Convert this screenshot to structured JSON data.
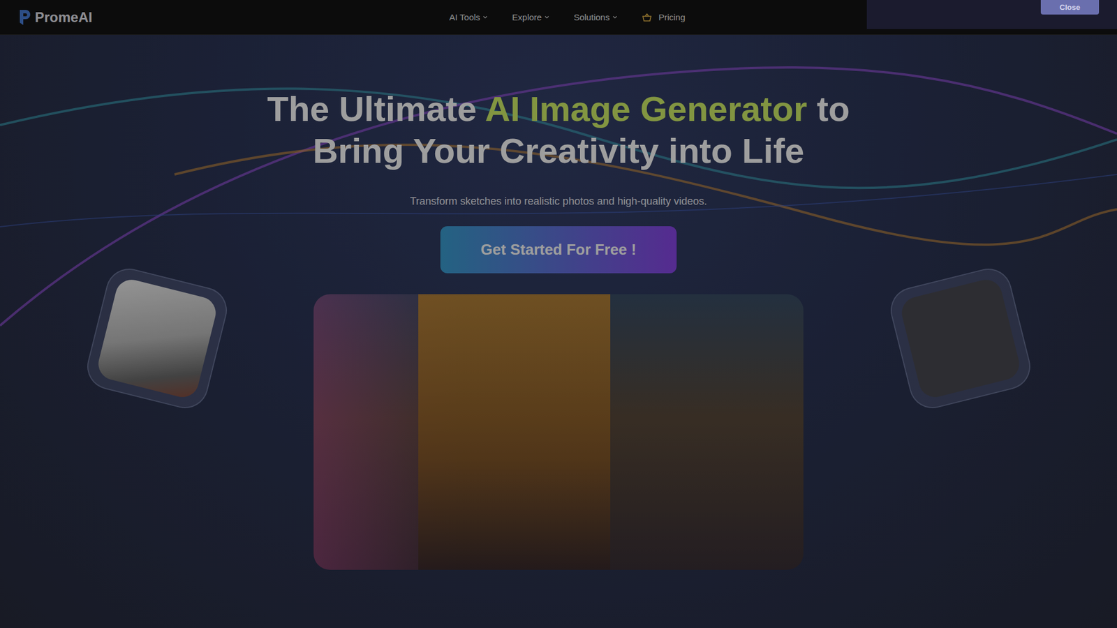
{
  "logo": {
    "text": "PromeAI"
  },
  "nav": [
    {
      "label": "AI Tools",
      "dropdown": true
    },
    {
      "label": "Explore",
      "dropdown": true
    },
    {
      "label": "Solutions",
      "dropdown": true
    },
    {
      "label": "Pricing",
      "dropdown": false
    }
  ],
  "hero": {
    "title_line1": [
      {
        "text": "The Ultimate",
        "highlight": false
      },
      {
        "text": "AI Image Generator",
        "highlight": true
      },
      {
        "text": "to",
        "highlight": false
      }
    ],
    "title_line2": "Bring Your Creativity into Life",
    "subtitle": "Transform sketches into realistic photos and high-quality videos.",
    "cta": "Get Started For Free !"
  },
  "overlay": {
    "dimmed": true
  },
  "notice": {
    "button": "Close"
  }
}
